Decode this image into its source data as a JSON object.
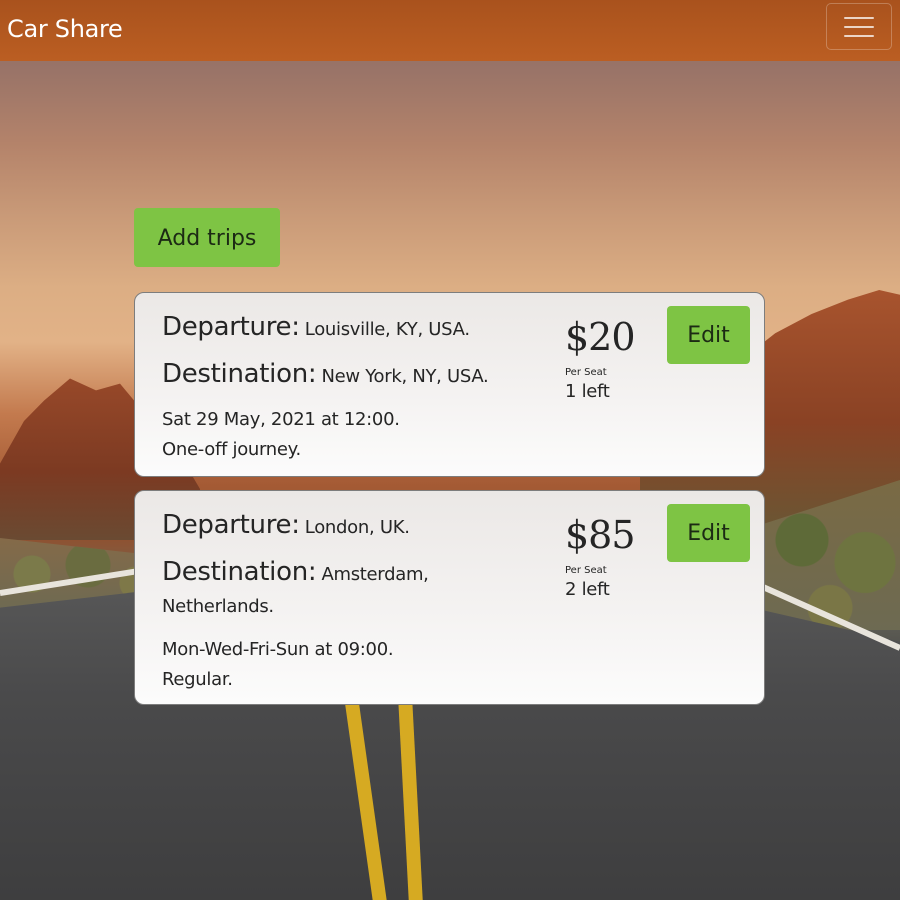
{
  "app": {
    "brand": "Car Share"
  },
  "navbar": {
    "menu_icon": "hamburger-menu-icon"
  },
  "actions": {
    "add_trips_label": "Add trips"
  },
  "labels": {
    "departure": "Departure:",
    "destination": "Destination:",
    "per_seat": "Per Seat",
    "edit": "Edit"
  },
  "trips": [
    {
      "departure": "Louisville, KY, USA.",
      "destination": "New York, NY, USA.",
      "schedule": "Sat 29 May, 2021 at 12:00.",
      "journey_type": "One-off journey.",
      "price": "$20",
      "seats_left": "1 left"
    },
    {
      "departure": "London, UK.",
      "destination": "Amsterdam, Netherlands.",
      "schedule": "Mon-Wed-Fri-Sun at 09:00.",
      "journey_type": "Regular.",
      "price": "$85",
      "seats_left": "2 left"
    }
  ],
  "theme": {
    "navbar_color": "#b4581f",
    "accent_green": "#7ec444",
    "card_border": "#7d7d7d"
  }
}
